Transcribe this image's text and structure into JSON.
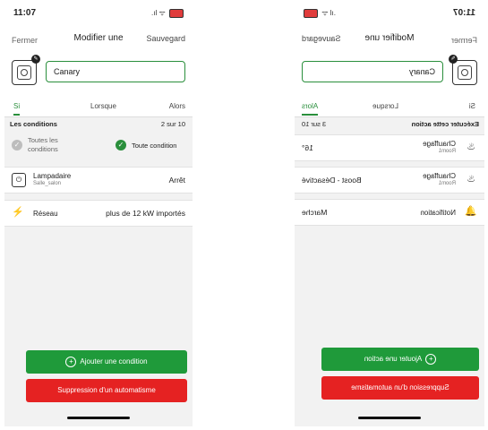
{
  "left": {
    "status": {
      "time": "11:07",
      "signal_icon": "signal-wifi-icons"
    },
    "nav": {
      "left": "Fermer",
      "title": "Modifier une",
      "right": "Sauvegard"
    },
    "name_value": "Canary",
    "tabs": [
      "Si",
      "Lorsque",
      "Alors"
    ],
    "conditions_header": {
      "label": "Les conditions",
      "count": "2 sur 10"
    },
    "options": {
      "all_line1": "Toutes les",
      "all_line2": "conditions",
      "any": "Toute condition"
    },
    "cards": [
      {
        "title": "Lampadaire",
        "subtitle": "Salle_salon",
        "value": "Arrêt",
        "icon": "power-icon"
      },
      {
        "title": "Réseau",
        "value": "plus de 12 kW importés",
        "icon": "pylon-icon"
      }
    ],
    "buttons": {
      "add": "Ajouter une condition",
      "delete": "Suppression d'un automatisme"
    }
  },
  "right": {
    "status": {
      "time": "11:07"
    },
    "nav": {
      "left": "Fermer",
      "title": "Modifier une",
      "right": "Sauvegard"
    },
    "name_value": "Canary",
    "tabs": [
      "Si",
      "Lorsque",
      "Alors"
    ],
    "actions_header": {
      "label": "Exécuter cette action",
      "count": "3 sur 10"
    },
    "cards": [
      {
        "title": "Chauffage",
        "subtitle": "Room1",
        "value": "16°",
        "icon": "flame-icon"
      },
      {
        "title": "Chauffage",
        "subtitle": "Room1",
        "value": "Boost - Désactivé",
        "icon": "flame-icon"
      },
      {
        "title": "Notification",
        "value": "Marche",
        "icon": "bell-icon"
      }
    ],
    "buttons": {
      "add": "Ajouter une action",
      "delete": "Suppression d'un automatisme"
    }
  },
  "colors": {
    "accent": "#2a8f3c",
    "add_button": "#1f9a3a",
    "delete_button": "#e52222"
  }
}
